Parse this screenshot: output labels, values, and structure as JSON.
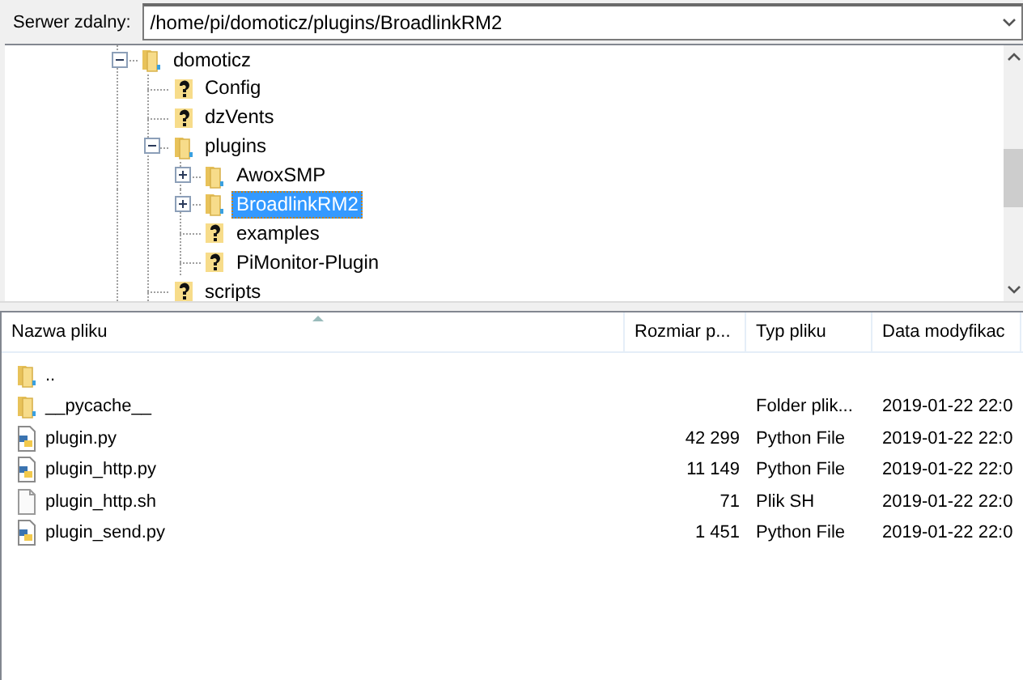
{
  "address_bar": {
    "label": "Serwer zdalny:",
    "path": "/home/pi/domoticz/plugins/BroadlinkRM2"
  },
  "tree": [
    {
      "name": "domoticz",
      "kind": "folder",
      "expanded": true,
      "selected": false,
      "children": [
        {
          "name": "Config",
          "kind": "unknown",
          "selected": false
        },
        {
          "name": "dzVents",
          "kind": "unknown",
          "selected": false
        },
        {
          "name": "plugins",
          "kind": "folder",
          "expanded": true,
          "selected": false,
          "children": [
            {
              "name": "AwoxSMP",
              "kind": "folder",
              "expanded": false,
              "selected": false
            },
            {
              "name": "BroadlinkRM2",
              "kind": "folder",
              "expanded": false,
              "selected": true
            },
            {
              "name": "examples",
              "kind": "unknown",
              "selected": false
            },
            {
              "name": "PiMonitor-Plugin",
              "kind": "unknown",
              "selected": false
            }
          ]
        },
        {
          "name": "scripts",
          "kind": "unknown",
          "selected": false
        }
      ]
    }
  ],
  "file_list": {
    "columns": [
      "Nazwa pliku",
      "Rozmiar p...",
      "Typ pliku",
      "Data modyfikac"
    ],
    "rows": [
      {
        "kind": "folder",
        "name": ".."
      },
      {
        "kind": "folder",
        "name": "__pycache__",
        "type": "Folder plik...",
        "modified": "2019-01-22 22:0"
      },
      {
        "kind": "python",
        "name": "plugin.py",
        "size": "42 299",
        "type": "Python File",
        "modified": "2019-01-22 22:0"
      },
      {
        "kind": "python",
        "name": "plugin_http.py",
        "size": "11 149",
        "type": "Python File",
        "modified": "2019-01-22 22:0"
      },
      {
        "kind": "file",
        "name": "plugin_http.sh",
        "size": "71",
        "type": "Plik SH",
        "modified": "2019-01-22 22:0"
      },
      {
        "kind": "python",
        "name": "plugin_send.py",
        "size": "1 451",
        "type": "Python File",
        "modified": "2019-01-22 22:0"
      }
    ]
  }
}
